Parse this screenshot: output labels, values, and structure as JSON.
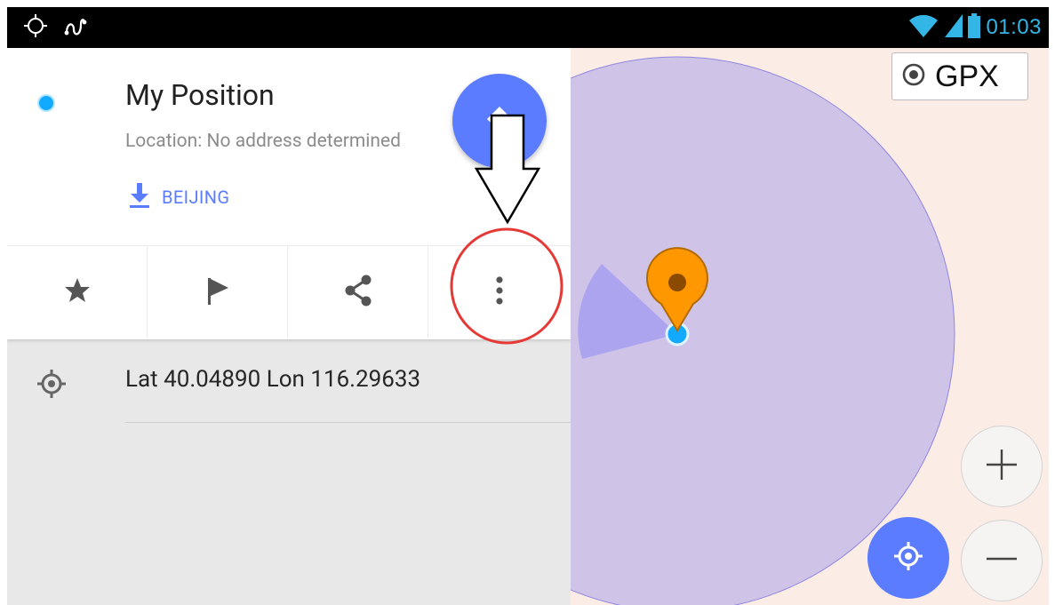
{
  "status_bar": {
    "time": "01:03",
    "left_icons": [
      "location-crosshair-icon",
      "route-track-icon"
    ],
    "right_icons": [
      "wifi-icon",
      "signal-icon",
      "battery-icon"
    ]
  },
  "location_card": {
    "title": "My Position",
    "subtitle": "Location: No address determined",
    "download_label": "BEIJING",
    "directions_button_icon": "directions-icon"
  },
  "actions": [
    {
      "name": "favorite",
      "icon": "star-icon"
    },
    {
      "name": "marker",
      "icon": "flag-icon"
    },
    {
      "name": "share",
      "icon": "share-icon"
    },
    {
      "name": "more",
      "icon": "more-vertical-icon"
    }
  ],
  "coordinates": {
    "text": "Lat 40.04890 Lon 116.29633",
    "icon": "crosshair-icon"
  },
  "map": {
    "gpx_label": "GPX",
    "zoom_in_label": "+",
    "zoom_out_label": "−"
  },
  "colors": {
    "accent": "#5b7cff",
    "accuracy_circle": "#cfc3e8",
    "marker": "#ff9800",
    "annotation_circle": "#e53935",
    "status_bar_icons": "#33b5e5"
  }
}
